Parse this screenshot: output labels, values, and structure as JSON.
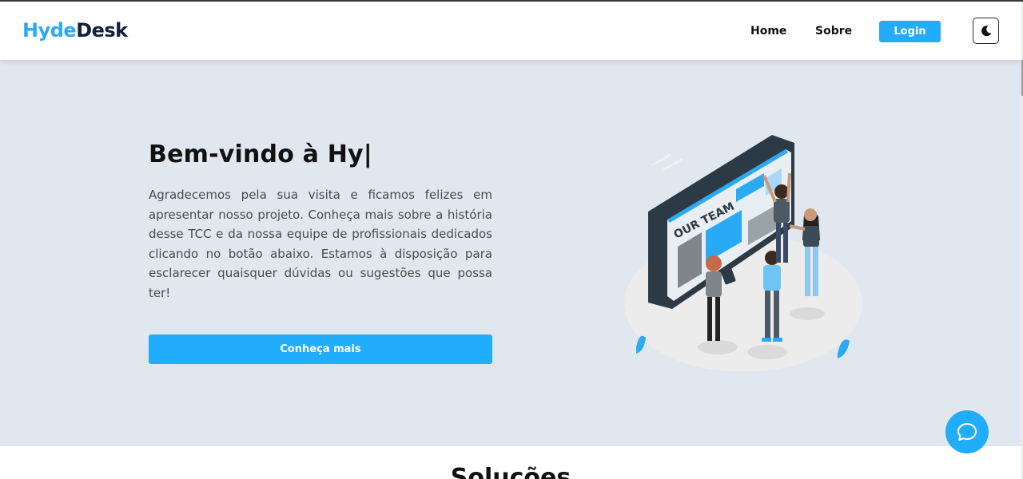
{
  "brand": {
    "part1": "Hyde",
    "part2": "Desk",
    "accent": "#2aaaf5",
    "dark": "#14213d"
  },
  "nav": {
    "home": "Home",
    "about": "Sobre",
    "login": "Login",
    "theme_icon": "moon-icon"
  },
  "hero": {
    "title": "Bem-vindo à Hy|",
    "text": "Agradecemos pela sua visita e ficamos felizes em apresentar nosso projeto. Conheça mais sobre a história desse TCC e da nossa equipe de profissionais dedicados clicando no botão abaixo. Estamos à disposição para esclarecer quaisquer dúvidas ou sugestões que possa ter!",
    "cta": "Conheça mais",
    "illustration_label": "OUR TEAM",
    "background": "#e1e7ef"
  },
  "chat": {
    "icon": "chat-bubble-icon"
  },
  "sections": {
    "solutions_title": "Soluções"
  }
}
